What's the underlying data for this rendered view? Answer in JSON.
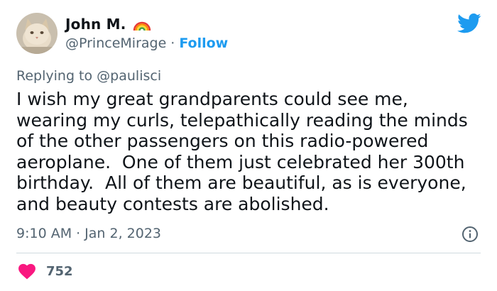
{
  "author": {
    "display_name": "John M.",
    "handle": "@PrinceMirage",
    "follow_label": "Follow",
    "badge_icon": "rainbow-icon",
    "avatar": "cat-avatar"
  },
  "separator": "·",
  "reply": {
    "prefix": "Replying to",
    "mention": "@paulisci"
  },
  "text_lines": [
    "I wish my great grandparents could see me,",
    "wearing my curls, telepathically reading the minds",
    "of the other passengers on this radio-powered",
    "aeroplane.  One of them just celebrated her 300th",
    "birthday.  All of them are beautiful, as is everyone,",
    "and beauty contests are abolished."
  ],
  "meta": {
    "time": "9:10 AM",
    "date": "Jan 2, 2023"
  },
  "engagement": {
    "likes": "752"
  },
  "colors": {
    "accent": "#1d9bf0",
    "secondary_text": "#536471",
    "heart": "#f91880",
    "divider": "#cfd9de"
  },
  "icons": {
    "brand": "twitter-bird-icon",
    "info": "info-icon",
    "like": "heart-icon"
  }
}
